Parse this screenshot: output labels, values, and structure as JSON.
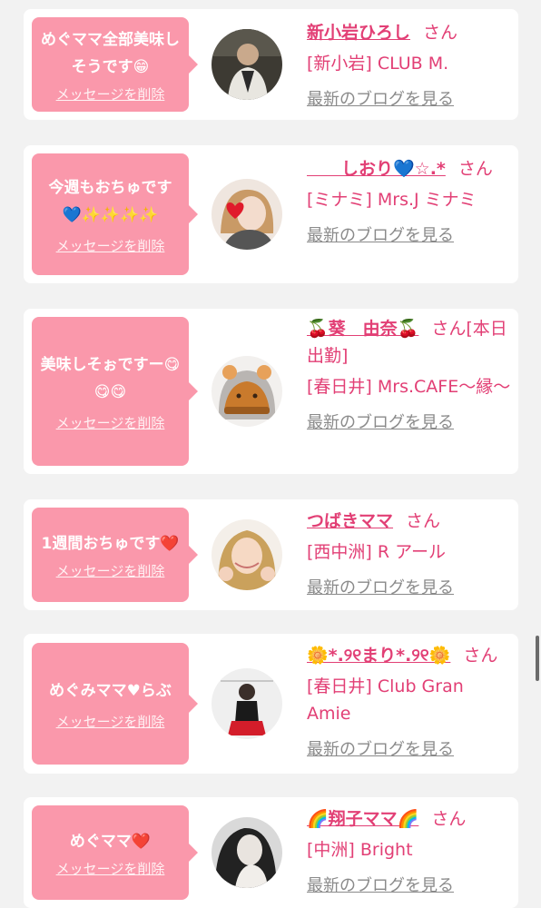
{
  "delete_label": "メッセージを削除",
  "blog_label": "最新のブログを見る",
  "san_label": "さん",
  "cards": [
    {
      "message": "めぐママ全部美味しそうです😁",
      "name": "新小岩ひろし",
      "san": "さん",
      "shop": "[新小岩] CLUB M."
    },
    {
      "message": "今週もおちゅです💙✨✨✨✨",
      "name": "　　しおり💙☆.*",
      "san": "さん",
      "shop": "[ミナミ] Mrs.J ミナミ"
    },
    {
      "message": "美味しそぉですー😋😋😋",
      "name": "🍒葵　由奈🍒",
      "san": "さん[本日出勤]",
      "shop": "[春日井] Mrs.CAFE～縁～"
    },
    {
      "message": "1週間おちゅです❤️",
      "name": "つばきママ",
      "san": "さん",
      "shop": "[西中洲] R アール"
    },
    {
      "message": "めぐみママ♥らぶ",
      "name": "🌼*.୨୧まり*.୨୧🌼",
      "san": "さん",
      "shop": "[春日井] Club Gran Amie"
    },
    {
      "message": "めぐママ❤️",
      "name": "🌈翔子ママ🌈",
      "san": "さん",
      "shop": "[中洲] Bright"
    }
  ],
  "colors": {
    "accent": "#e23f75",
    "bubble": "#fa98ab",
    "link": "#8a8a8a"
  }
}
